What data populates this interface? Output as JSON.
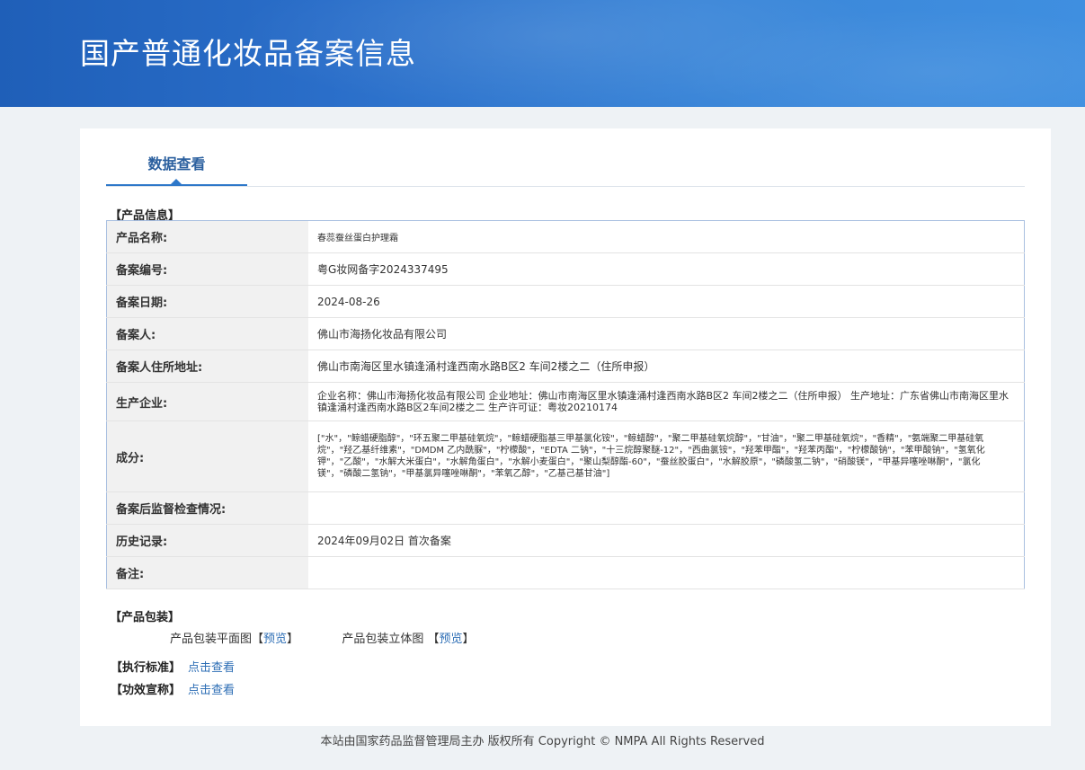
{
  "banner": {
    "title": "国产普通化妆品备案信息"
  },
  "tabs": {
    "active": "数据查看"
  },
  "product_info": {
    "heading": "【产品信息】",
    "rows": [
      {
        "label": "产品名称:",
        "value": "春蕊蚕丝蛋白护理霜"
      },
      {
        "label": "备案编号:",
        "value": "粤G妆网备字2024337495"
      },
      {
        "label": "备案日期:",
        "value": "2024-08-26"
      },
      {
        "label": "备案人:",
        "value": "佛山市海扬化妆品有限公司"
      },
      {
        "label": "备案人住所地址:",
        "value": "佛山市南海区里水镇逢涌村逢西南水路B区2 车间2楼之二（住所申报）"
      },
      {
        "label": "生产企业:",
        "value": "企业名称：佛山市海扬化妆品有限公司 企业地址：佛山市南海区里水镇逢涌村逢西南水路B区2 车间2楼之二（住所申报） 生产地址：广东省佛山市南海区里水镇逢涌村逢西南水路B区2车间2楼之二 生产许可证：粤妆20210174"
      },
      {
        "label": "成分:",
        "value": "[\"水\"，\"鲸蜡硬脂醇\"，\"环五聚二甲基硅氧烷\"，\"鲸蜡硬脂基三甲基氯化铵\"，\"鲸蜡醇\"，\"聚二甲基硅氧烷醇\"，\"甘油\"，\"聚二甲基硅氧烷\"，\"香精\"，\"氨端聚二甲基硅氧烷\"，\"羟乙基纤维素\"，\"DMDM 乙内酰脲\"，\"柠檬酸\"，\"EDTA 二钠\"，\"十三烷醇聚醚-12\"，\"西曲氯铵\"，\"羟苯甲酯\"，\"羟苯丙酯\"，\"柠檬酸钠\"，\"苯甲酸钠\"，\"氢氧化钾\"，\"乙酸\"，\"水解大米蛋白\"，\"水解角蛋白\"，\"水解小麦蛋白\"，\"聚山梨醇酯-60\"，\"蚕丝胶蛋白\"，\"水解胶原\"，\"磷酸氢二钠\"，\"硝酸镁\"，\"甲基异噻唑啉酮\"，\"氯化镁\"，\"磷酸二氢钠\"，\"甲基氯异噻唑啉酮\"，\"苯氧乙醇\"，\"乙基己基甘油\"]"
      },
      {
        "label": "备案后监督检查情况:",
        "value": ""
      },
      {
        "label": "历史记录:",
        "value": "2024年09月02日 首次备案"
      },
      {
        "label": "备注:",
        "value": ""
      }
    ]
  },
  "packaging": {
    "heading": "【产品包装】",
    "flat_label": "产品包装平面图",
    "solid_label": "产品包装立体图",
    "bracket_open": "【",
    "bracket_close": "】",
    "preview_label": "预览"
  },
  "standard": {
    "label": "【执行标准】",
    "link": "点击查看"
  },
  "efficacy": {
    "label": "【功效宣称】",
    "link": "点击查看"
  },
  "footer": {
    "text": "本站由国家药品监督管理局主办 版权所有 Copyright © NMPA All Rights Reserved"
  }
}
